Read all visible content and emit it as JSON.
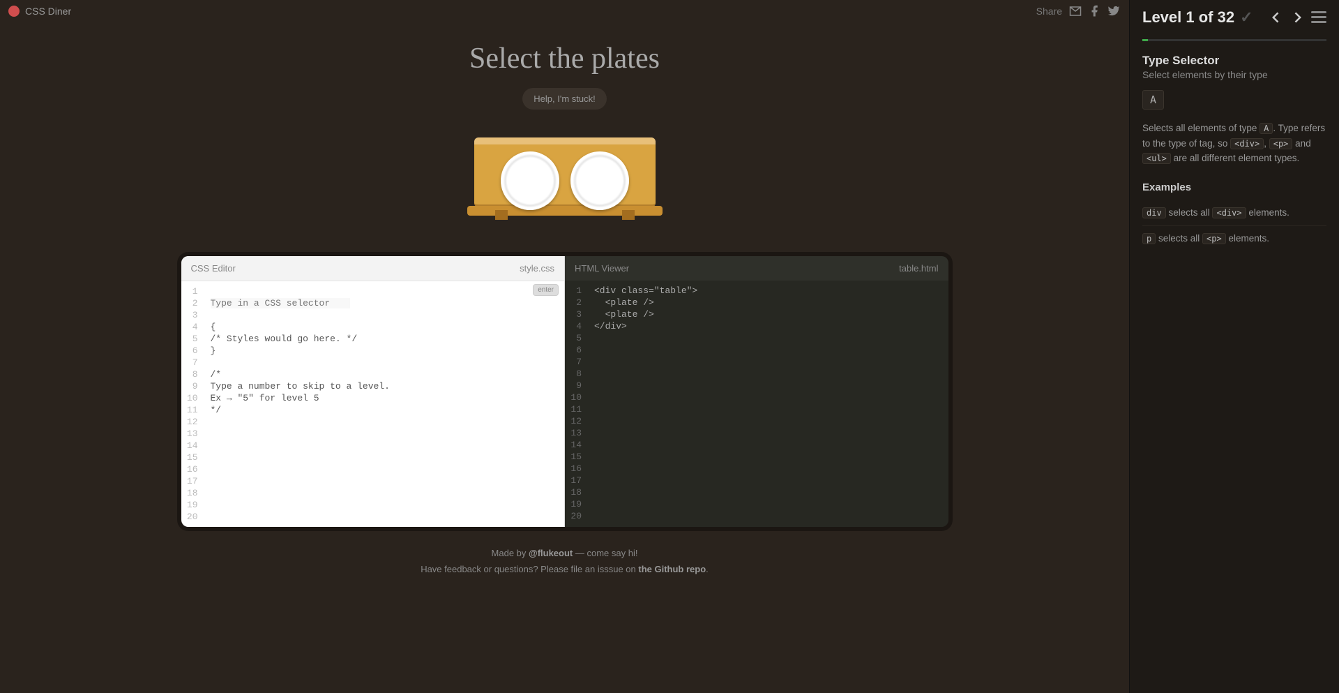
{
  "header": {
    "logo_text": "CSS Diner",
    "share_label": "Share"
  },
  "instruction": "Select the plates",
  "help_label": "Help, I'm stuck!",
  "editor": {
    "left_title": "CSS Editor",
    "left_file": "style.css",
    "right_title": "HTML Viewer",
    "right_file": "table.html",
    "enter_label": "enter",
    "line_numbers": [
      "1",
      "2",
      "3",
      "4",
      "5",
      "6",
      "7",
      "8",
      "9",
      "10",
      "11",
      "12",
      "13",
      "14",
      "15",
      "16",
      "17",
      "18",
      "19",
      "20"
    ],
    "css_placeholder": "Type in a CSS selector",
    "css_lines": [
      "{",
      "/* Styles would go here. */",
      "}",
      "",
      "/*",
      "Type a number to skip to a level.",
      "Ex → \"5\" for level 5",
      "*/"
    ],
    "html_lines": [
      "<div class=\"table\">",
      "  <plate />",
      "  <plate />",
      "</div>"
    ]
  },
  "footer": {
    "made_by": "Made by ",
    "author": "@flukeout",
    "made_by_tail": " — come say hi!",
    "feedback_pre": "Have feedback or questions? Please file an isssue on ",
    "feedback_link": "the Github repo",
    "feedback_post": "."
  },
  "sidebar": {
    "level_label": "Level 1 of 32",
    "selector_title": "Type Selector",
    "selector_subtitle": "Select elements by their type",
    "syntax": "A",
    "explain_1": "Selects all elements of type ",
    "chip_A": "A",
    "explain_2": ". Type refers to the type of tag, so ",
    "chip_div": "<div>",
    "explain_comma": ", ",
    "chip_p": "<p>",
    "explain_and": " and ",
    "chip_ul": "<ul>",
    "explain_3": " are all different element types.",
    "examples_label": "Examples",
    "ex1_chip": "div",
    "ex1_mid": " selects all ",
    "ex1_chip2": "<div>",
    "ex1_tail": " elements.",
    "ex2_chip": "p",
    "ex2_mid": " selects all ",
    "ex2_chip2": "<p>",
    "ex2_tail": " elements."
  }
}
